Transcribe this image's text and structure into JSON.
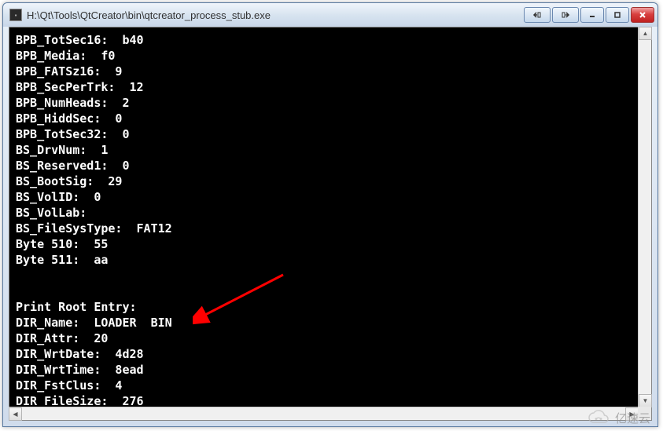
{
  "window": {
    "title": "H:\\Qt\\Tools\\QtCreator\\bin\\qtcreator_process_stub.exe"
  },
  "console": {
    "lines": [
      "BPB_TotSec16:  b40",
      "BPB_Media:  f0",
      "BPB_FATSz16:  9",
      "BPB_SecPerTrk:  12",
      "BPB_NumHeads:  2",
      "BPB_HiddSec:  0",
      "BPB_TotSec32:  0",
      "BS_DrvNum:  1",
      "BS_Reserved1:  0",
      "BS_BootSig:  29",
      "BS_VolID:  0",
      "BS_VolLab:",
      "BS_FileSysType:  FAT12",
      "Byte 510:  55",
      "Byte 511:  aa",
      "",
      "",
      "Print Root Entry:",
      "DIR_Name:  LOADER  BIN",
      "DIR_Attr:  20",
      "DIR_WrtDate:  4d28",
      "DIR_WrtTime:  8ead",
      "DIR_FstClus:  4",
      "DIR_FileSize:  276"
    ]
  },
  "annotation": {
    "arrow_color": "#ff0000"
  },
  "watermark": {
    "text": "亿速云"
  }
}
